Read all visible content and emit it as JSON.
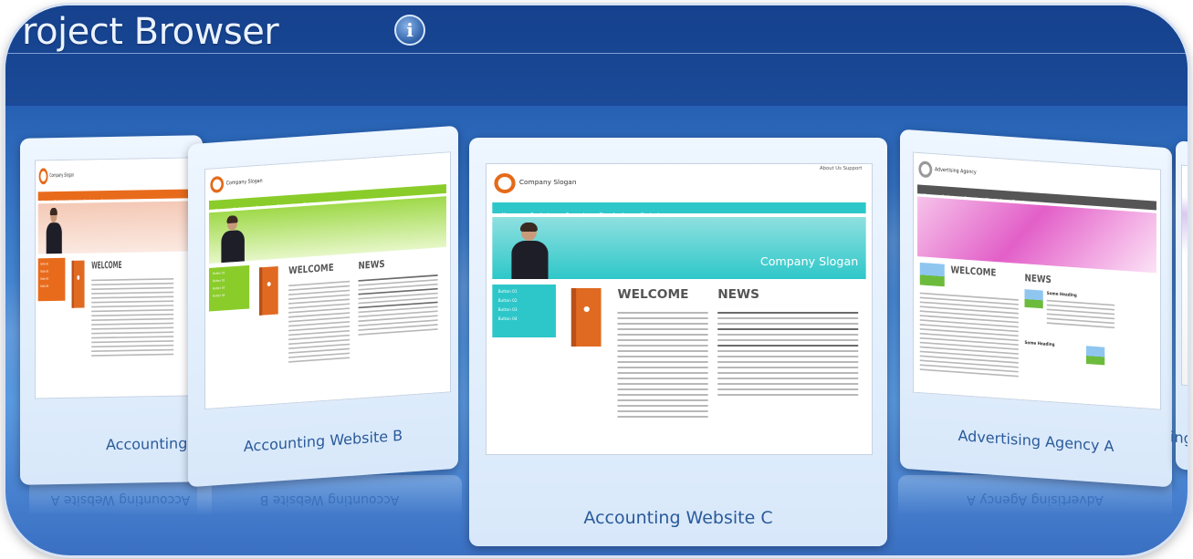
{
  "header": {
    "title": "roject Browser",
    "info_icon": "info-icon"
  },
  "projects": [
    {
      "label": "Accounting We",
      "theme": "orange",
      "accent": "#e86b1c"
    },
    {
      "label": "Accounting Website B",
      "theme": "green",
      "accent": "#8acc2a"
    },
    {
      "label": "Accounting Website C",
      "theme": "teal",
      "accent": "#2ec7c9"
    },
    {
      "label": "Advertising Agency A",
      "theme": "pink",
      "accent": "#e25fc8"
    },
    {
      "label": "ing",
      "theme": "partial",
      "accent": "#7aa0d6"
    }
  ],
  "mockup": {
    "slogan": "Company Slogan",
    "top_links": "About Us    Support",
    "nav_items": [
      "Home",
      "Products",
      "Support",
      "Downloads",
      "Contact"
    ],
    "banner_text": "Company Slogan",
    "welcome": "WELCOME",
    "news": "NEWS",
    "agency_name": "Advertising Agency",
    "news_heading": "Some Heading"
  },
  "reflections": [
    "Accounting Website A",
    "Accounting Website B",
    "Advertising Agency A"
  ],
  "colors": {
    "background_top": "#1f4e9e",
    "background_bottom": "#5a9ae0",
    "card_label": "#2a5a9a"
  }
}
